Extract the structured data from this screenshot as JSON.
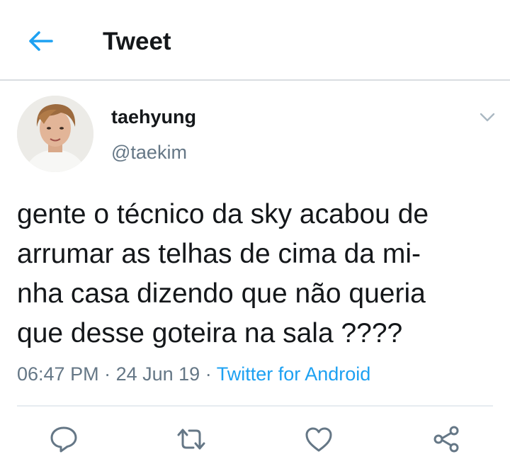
{
  "header": {
    "title": "Tweet"
  },
  "tweet": {
    "author_name": "taehyung",
    "author_handle": "@taekim",
    "lines": [
      "gente o técnico da sky acabou de",
      "arrumar as telhas de cima da mi-",
      "nha casa dizendo que não queria",
      "que desse goteira na sala ????"
    ],
    "time": "06:47 PM",
    "sep1": " · ",
    "date": "24 Jun 19",
    "sep2": " · ",
    "source": "Twitter for Android"
  },
  "icons": {
    "back": "arrow-left-icon",
    "more": "chevron-down-icon",
    "reply": "reply-icon",
    "retweet": "retweet-icon",
    "like": "heart-icon",
    "share": "share-icon"
  },
  "colors": {
    "accent": "#1da1f2",
    "text": "#14171a",
    "secondary": "#657786",
    "icon": "#657786",
    "divider": "#e6ecf0"
  }
}
